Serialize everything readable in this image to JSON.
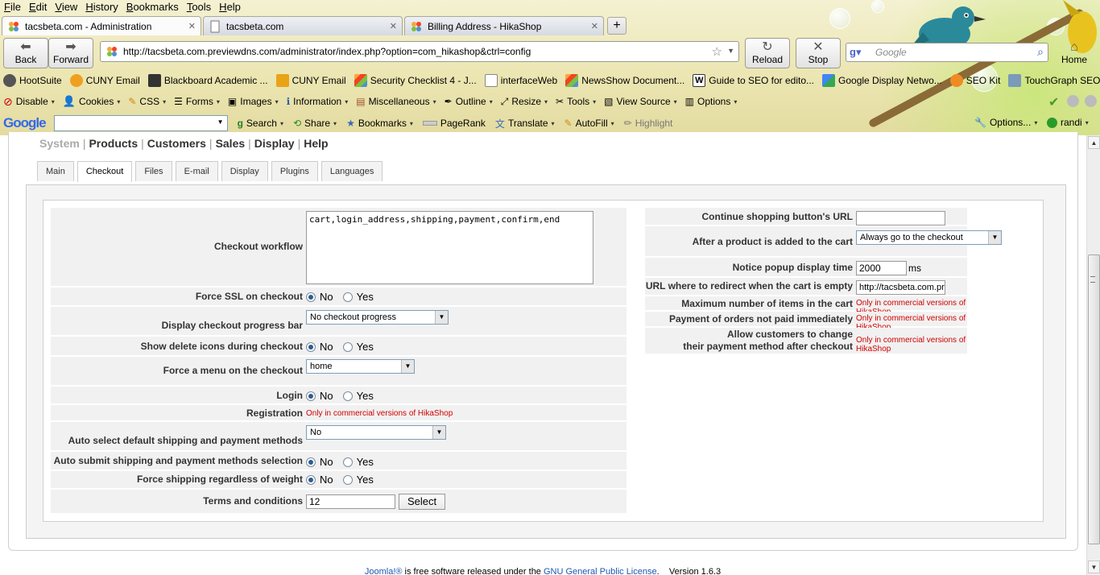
{
  "menu": [
    "File",
    "Edit",
    "View",
    "History",
    "Bookmarks",
    "Tools",
    "Help"
  ],
  "tabs": [
    {
      "title": "tacsbeta.com - Administration",
      "active": true
    },
    {
      "title": "tacsbeta.com",
      "active": false
    },
    {
      "title": "Billing Address - HikaShop",
      "active": false
    }
  ],
  "nav": {
    "back": "Back",
    "forward": "Forward",
    "url": "http://tacsbeta.com.previewdns.com/administrator/index.php?option=com_hikashop&ctrl=config",
    "reload": "Reload",
    "stop": "Stop",
    "search_placeholder": "Google",
    "home": "Home"
  },
  "bookmarks": [
    "HootSuite",
    "CUNY Email",
    "Blackboard Academic ...",
    "CUNY Email",
    "Security Checklist 4 - J...",
    "interfaceWeb",
    "NewsShow Document...",
    "Guide to SEO for edito...",
    "Google Display Netwo...",
    "SEO Kit",
    "TouchGraph SEO"
  ],
  "devtools": [
    "Disable",
    "Cookies",
    "CSS",
    "Forms",
    "Images",
    "Information",
    "Miscellaneous",
    "Outline",
    "Resize",
    "Tools",
    "View Source",
    "Options"
  ],
  "googlebar": {
    "logo": "Google",
    "search": "Search",
    "share": "Share",
    "bookmarks": "Bookmarks",
    "pagerank": "PageRank",
    "translate": "Translate",
    "autofill": "AutoFill",
    "highlight": "Highlight",
    "options": "Options...",
    "user": "randi"
  },
  "topnav": {
    "system": "System",
    "products": "Products",
    "customers": "Customers",
    "sales": "Sales",
    "display": "Display",
    "help": "Help"
  },
  "subtabs": [
    "Main",
    "Checkout",
    "Files",
    "E-mail",
    "Display",
    "Plugins",
    "Languages"
  ],
  "left_form": {
    "checkout_workflow": {
      "label": "Checkout workflow",
      "value": "cart,login_address,shipping,payment,confirm,end"
    },
    "force_ssl": {
      "label": "Force SSL on checkout",
      "no": "No",
      "yes": "Yes"
    },
    "progress_bar": {
      "label": "Display checkout progress bar",
      "value": "No checkout progress"
    },
    "delete_icons": {
      "label": "Show delete icons during checkout",
      "no": "No",
      "yes": "Yes"
    },
    "force_menu": {
      "label": "Force a menu on the checkout",
      "value": "home"
    },
    "login": {
      "label": "Login",
      "no": "No",
      "yes": "Yes"
    },
    "registration": {
      "label": "Registration",
      "value": "Only in commercial versions of HikaShop"
    },
    "auto_select": {
      "label": "Auto select default shipping and payment methods",
      "value": "No"
    },
    "auto_submit": {
      "label": "Auto submit shipping and payment methods selection",
      "no": "No",
      "yes": "Yes"
    },
    "force_shipping": {
      "label": "Force shipping regardless of weight",
      "no": "No",
      "yes": "Yes"
    },
    "terms": {
      "label": "Terms and conditions",
      "value": "12",
      "button": "Select"
    }
  },
  "right_form": {
    "continue_url": {
      "label": "Continue shopping button's URL",
      "value": ""
    },
    "after_add": {
      "label": "After a product is added to the cart",
      "value": "Always go to the checkout"
    },
    "popup_time": {
      "label": "Notice popup display time",
      "value": "2000",
      "unit": "ms"
    },
    "redirect_empty": {
      "label": "URL where to redirect when the cart is empty",
      "value": "http://tacsbeta.com.previewdns.com"
    },
    "max_items": {
      "label": "Maximum number of items in the cart",
      "value": "Only in commercial versions of HikaShop"
    },
    "unpaid_orders": {
      "label": "Payment of orders not paid immediately",
      "value": "Only in commercial versions of HikaShop"
    },
    "change_payment": {
      "label_line1": "Allow customers to change",
      "label_line2": "their payment method after checkout",
      "value": "Only in commercial versions of HikaShop"
    }
  },
  "footer": {
    "joomla": "Joomla!®",
    "text1": " is free software released under the ",
    "license": "GNU General Public License",
    "text2": ".",
    "version": "Version 1.6.3"
  },
  "colors": {
    "commercial_note": "#d00000",
    "link": "#1b57b1"
  }
}
